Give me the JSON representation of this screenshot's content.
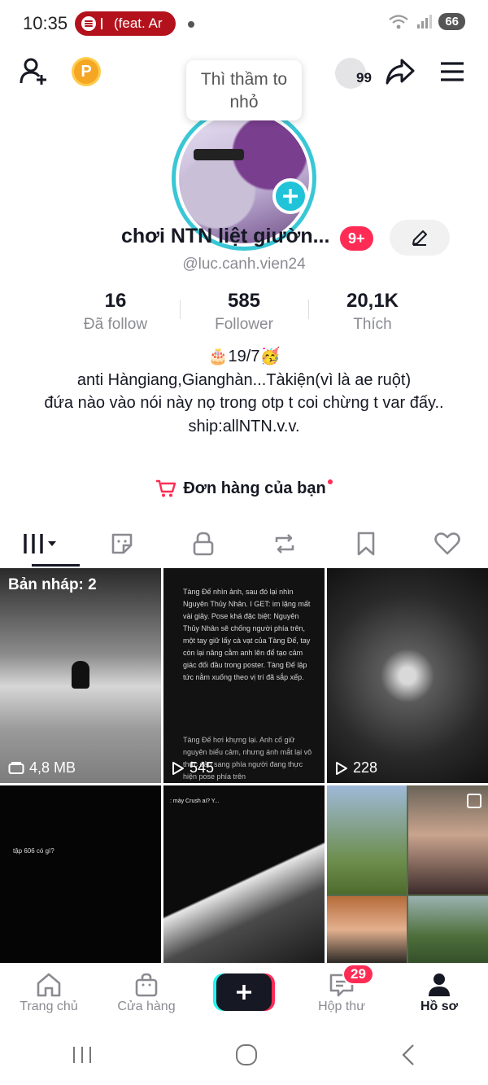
{
  "status_bar": {
    "time": "10:35",
    "media_text": "(feat. Ar",
    "battery": "66"
  },
  "header": {
    "coin_label": "P",
    "notification_count": "99"
  },
  "tooltip": {
    "text": "Thì thầm to nhỏ"
  },
  "profile": {
    "name": "chơi NTN liệt giườn...",
    "notification_badge": "9+",
    "handle": "@luc.canh.vien24"
  },
  "stats": [
    {
      "value": "16",
      "label": "Đã follow"
    },
    {
      "value": "585",
      "label": "Follower"
    },
    {
      "value": "20,1K",
      "label": "Thích"
    }
  ],
  "bio": {
    "line1": "🎂19/7🥳",
    "line2": "anti Hàngiang,Gianghàn...Tàkiện(vì là ae ruột)",
    "line3": "đứa nào vào nói này nọ trong otp t coi chừng t var đấy..",
    "line4": "ship:allNTN.v.v."
  },
  "orders": {
    "label": "Đơn hàng của bạn"
  },
  "tabs": [
    {
      "icon": "videos-grid-icon"
    },
    {
      "icon": "sticker-icon"
    },
    {
      "icon": "lock-icon"
    },
    {
      "icon": "repost-icon"
    },
    {
      "icon": "bookmark-icon"
    },
    {
      "icon": "heart-icon"
    }
  ],
  "grid": {
    "drafts_label": "Bản nháp: 2",
    "drafts_size": "4,8 MB",
    "video2_views": "545",
    "video3_views": "228",
    "video2_text_top": "Tàng Đế nhìn ảnh, sau đó lại nhìn Nguyên Thủy Nhân. I GET: im lặng mất vài giây. Pose khá đặc biệt: Nguyên Thủy Nhân sẽ chống người phía trên, một tay giữ lấy cà vạt của Tàng Đế, tay còn lại nâng cằm anh lên để tạo cảm giác đối đầu trong poster. Tàng Đế lập tức nằm xuống theo vị trí đã sắp xếp.",
    "video2_text_bottom": "Tàng Đế hơi khựng lại. Anh cố giữ nguyên biểu cảm, nhưng ánh mắt lại vô thức đảo sang phía người đang thực hiện pose phía trên",
    "video4_text": "tập 606 có gì?",
    "video5_text": ": mày Crush ai? Y..."
  },
  "bottom_nav": [
    {
      "label": "Trang chủ",
      "icon": "home-icon"
    },
    {
      "label": "Cửa hàng",
      "icon": "shop-icon"
    },
    {
      "label": "",
      "icon": "create-plus-icon"
    },
    {
      "label": "Hộp thư",
      "icon": "inbox-icon",
      "badge": "29"
    },
    {
      "label": "Hồ sơ",
      "icon": "profile-icon"
    }
  ],
  "colors": {
    "accent_pink": "#fe2c55",
    "accent_cyan": "#25f4ee",
    "text_primary": "#161823",
    "text_secondary": "#8a8b91"
  }
}
